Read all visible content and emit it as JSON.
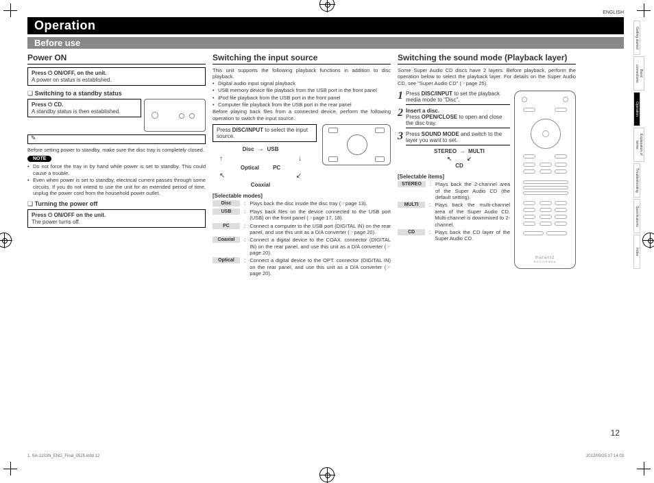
{
  "lang": "ENGLISH",
  "title": "Operation",
  "subtitle": "Before use",
  "page_num": "12",
  "footer_left": "1. SA-11S3N_ENG_Final_0525.indd   12",
  "footer_right": "2012/05/25   17:14:03",
  "sidebar": [
    "Getting started",
    "Basic connections",
    "Operation",
    "Explanation of terms",
    "Troubleshooting",
    "Specifications",
    "Index"
  ],
  "sidebar_active_index": 2,
  "col1": {
    "h_power": "Power ON",
    "instr_power": "Press ⏻ ON/OFF, on the unit.",
    "instr_power_sub": "A power on status is established.",
    "h_standby": "Switching to a standby status",
    "instr_standby": "Press ⏻ CD.",
    "instr_standby_sub": "A standby status is then established.",
    "pre_note": "Before setting power to standby, make sure the disc tray is completely closed.",
    "note_label": "NOTE",
    "notes": [
      "Do not force the tray in by hand while power is set to standby. This could cause a trouble.",
      "Even when power is set to standby, electrical current passes through some circuits. If you do not intend to use the unit for an extended period of time, unplug the power cord from the household power outlet."
    ],
    "h_off": "Turning the power off",
    "instr_off": "Press ⏻ ON/OFF on the unit.",
    "instr_off_sub": "The power turns off."
  },
  "col2": {
    "heading": "Switching the input source",
    "intro": "This unit supports the following playback functions in addition to disc playback.",
    "intro_list": [
      "Digital audio input signal playback",
      "USB memory device file playback from the USB port in the front panel",
      "iPod file playback from the USB port in the front panel",
      "Computer file playback from the USB port in the rear panel"
    ],
    "intro2": "Before playing back files from a connected device, perform the following operation to switch the input source.",
    "instr": "Press DISC/INPUT to select the input source.",
    "flow": {
      "a": "Disc",
      "b": "USB",
      "c": "Optical",
      "d": "PC",
      "e": "Coaxial"
    },
    "sel_head": "[Selectable modes]",
    "modes": [
      {
        "k": "Disc",
        "v": "Plays back the disc inside the disc tray (☞page 13)."
      },
      {
        "k": "USB",
        "v": "Plays back files on the device connected to the USB port (USB) on the front panel (☞page 17, 18)."
      },
      {
        "k": "PC",
        "v": "Connect a computer to the USB port (DIGITAL IN) on the rear panel, and use this unit as a D/A converter (☞page 20)."
      },
      {
        "k": "Coaxial",
        "v": "Connect a digital device to the COAX. connector (DIGITAL IN) on the rear panel, and use this unit as a D/A converter (☞page 20)."
      },
      {
        "k": "Optical",
        "v": "Connect a digital device to the OPT. connector (DIGITAL IN) on the rear panel, and use this unit as a D/A converter (☞page 20)."
      }
    ]
  },
  "col3": {
    "heading": "Switching the sound mode (Playback layer)",
    "intro": "Some Super Audio CD discs have 2 layers. Before playback, perform the operation below to select the playback layer. For details on the Super Audio CD, see \"Super Audio CD\" (☞page 25).",
    "steps": [
      {
        "n": "1",
        "t": "Press <b>DISC/INPUT</b> to set the playback media mode to \"Disc\"."
      },
      {
        "n": "2",
        "t": "Insert a disc.<br>Press <b>OPEN/CLOSE</b> to open and close the disc tray."
      },
      {
        "n": "3",
        "t": "Press <b>SOUND MODE</b> and switch to the layer you want to set."
      }
    ],
    "flow": {
      "a": "STEREO",
      "b": "MULTI",
      "c": "CD"
    },
    "sel_head": "[Selectable items]",
    "items": [
      {
        "k": "STEREO",
        "v": "Plays back the 2-channel area of the Super Audio CD (the default setting)."
      },
      {
        "k": "MULTI",
        "v": "Plays back the multi-channel area of the Super Audio CD. Multi-channel is downmixed to 2-channel."
      },
      {
        "k": "CD",
        "v": "Plays back the CD layer of the Super Audio CD."
      }
    ],
    "remote_logo": "marantz",
    "remote_model": "RC011PMSA"
  }
}
